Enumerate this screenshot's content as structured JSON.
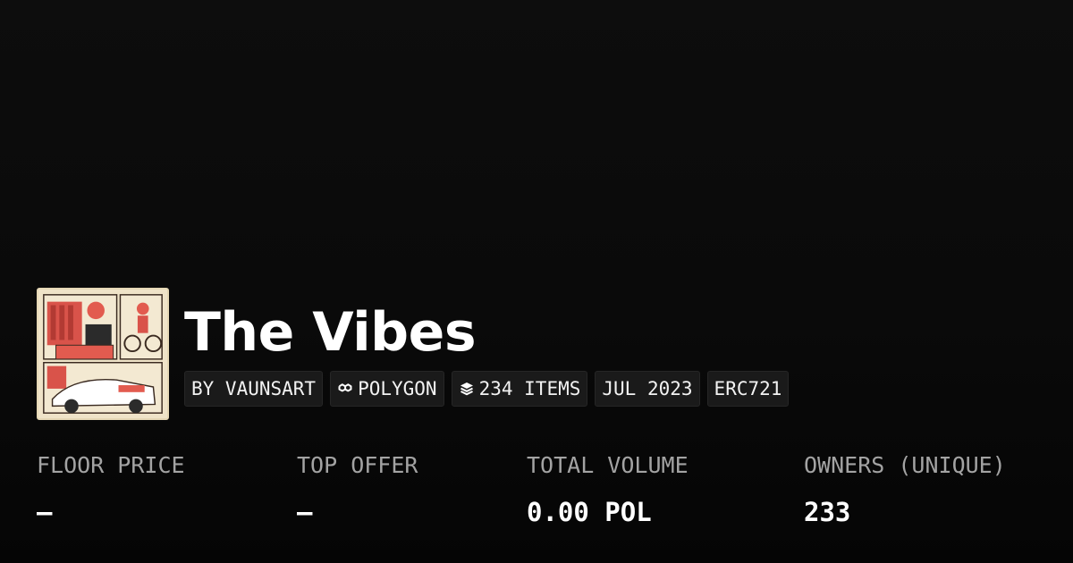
{
  "collection": {
    "title": "The Vibes",
    "thumbnail_alt": "artwork"
  },
  "badges": [
    {
      "label": "BY VAUNSART",
      "icon": null
    },
    {
      "label": "POLYGON",
      "icon": "polygon-icon"
    },
    {
      "label": "234 ITEMS",
      "icon": "layers-icon"
    },
    {
      "label": "JUL 2023",
      "icon": null
    },
    {
      "label": "ERC721",
      "icon": null
    }
  ],
  "stats": [
    {
      "label": "FLOOR PRICE",
      "value": "–"
    },
    {
      "label": "TOP OFFER",
      "value": "–"
    },
    {
      "label": "TOTAL VOLUME",
      "value": "0.00 POL"
    },
    {
      "label": "OWNERS (UNIQUE)",
      "value": "233"
    }
  ],
  "colors": {
    "background": "#0a0a0a",
    "badge_bg": "#1a1a1a",
    "label": "#a3a3a3",
    "text": "#ffffff"
  }
}
